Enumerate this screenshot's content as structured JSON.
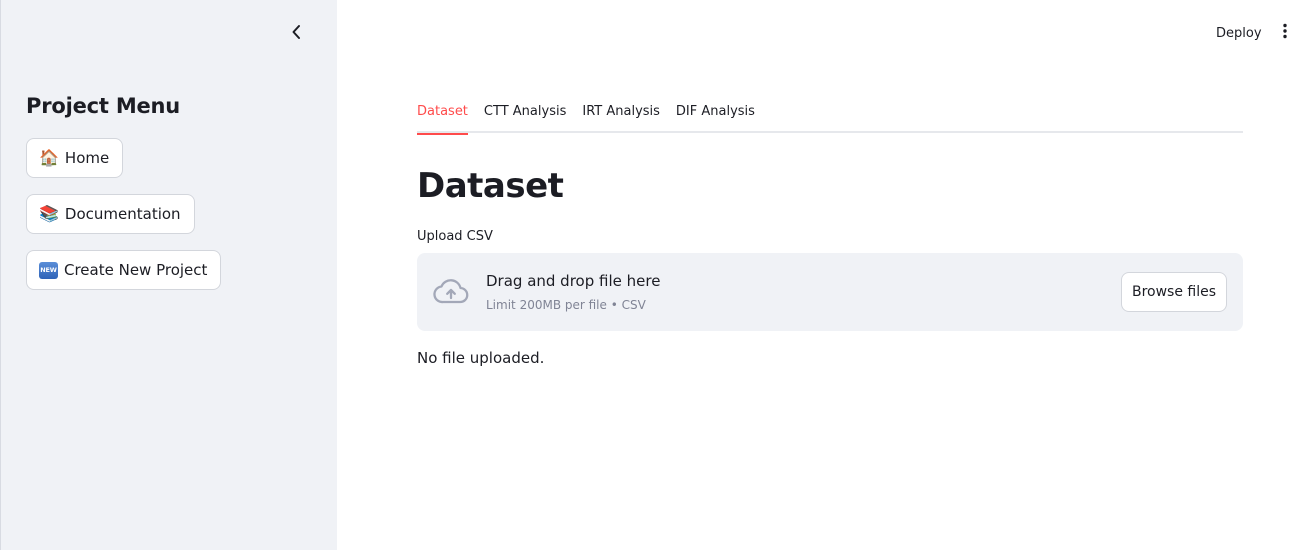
{
  "header": {
    "deploy_label": "Deploy",
    "menu_icon": "vertical-ellipsis-icon"
  },
  "sidebar": {
    "collapse_icon": "chevron-left-icon",
    "title": "Project Menu",
    "buttons": [
      {
        "emoji": "🏠",
        "label": "Home"
      },
      {
        "emoji": "📚",
        "label": "Documentation"
      },
      {
        "badge": "NEW",
        "label": "Create New Project"
      }
    ]
  },
  "main": {
    "tabs": [
      {
        "label": "Dataset",
        "active": true
      },
      {
        "label": "CTT Analysis",
        "active": false
      },
      {
        "label": "IRT Analysis",
        "active": false
      },
      {
        "label": "DIF Analysis",
        "active": false
      }
    ],
    "title": "Dataset",
    "uploader": {
      "label": "Upload CSV",
      "icon": "cloud-upload-icon",
      "drop_title": "Drag and drop file here",
      "drop_subtitle": "Limit 200MB per file • CSV",
      "browse_label": "Browse files"
    },
    "status": "No file uploaded."
  },
  "colors": {
    "accent": "#ff4b4b",
    "sidebar_bg": "#f0f2f6",
    "dropzone_bg": "#f0f2f6",
    "text": "#1c1d24",
    "muted_text": "#808495"
  }
}
